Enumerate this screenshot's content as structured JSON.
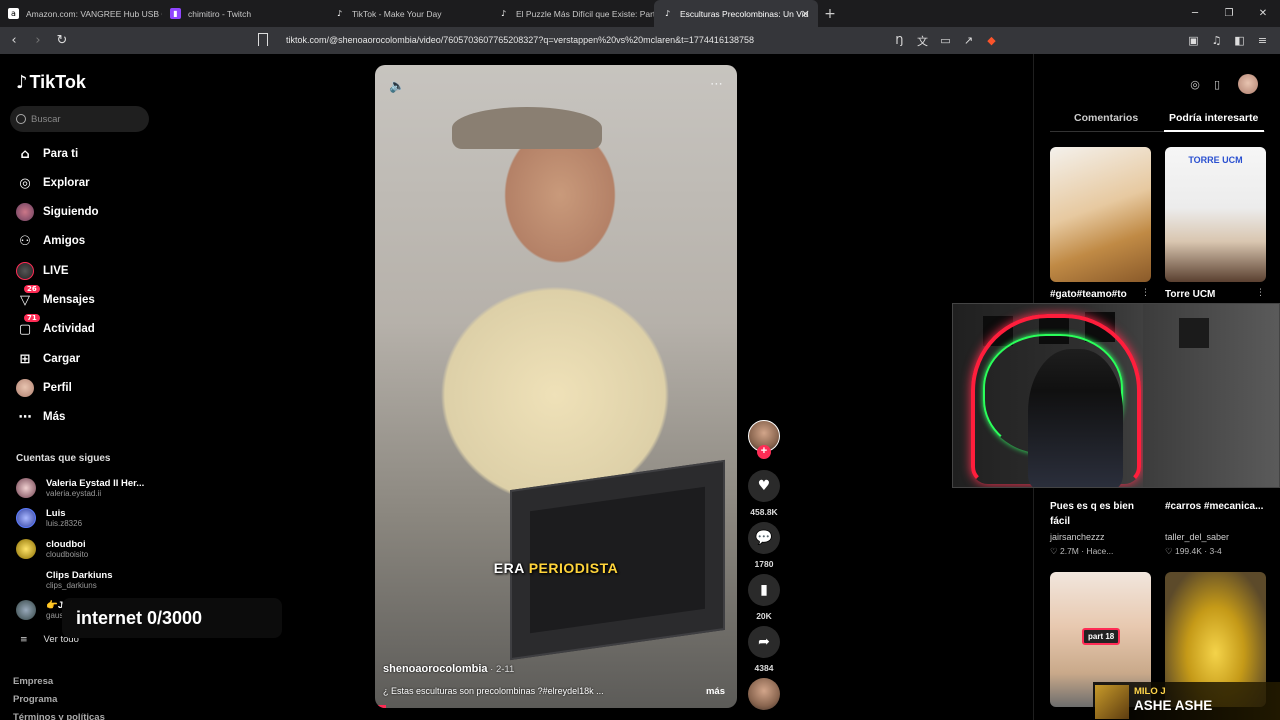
{
  "browser": {
    "tabs": [
      {
        "title": "Amazon.com: VANGREE Hub USB C,",
        "active": false,
        "icon": "amazon-icon"
      },
      {
        "title": "chimitiro - Twitch",
        "active": false,
        "icon": "twitch-icon"
      },
      {
        "title": "TikTok - Make Your Day",
        "active": false,
        "icon": "tiktok-icon"
      },
      {
        "title": "El Puzzle Más Difícil que Existe: Parte",
        "active": false,
        "icon": "tiktok-icon"
      },
      {
        "title": "Esculturas Precolombinas: Un Vid",
        "active": true,
        "icon": "tiktok-icon"
      }
    ],
    "url": "tiktok.com/@shenoaorocolombia/video/7605703607765208327?q=verstappen%20vs%20mclaren&t=1774416138758"
  },
  "sidebar": {
    "brand": "TikTok",
    "search_placeholder": "Buscar",
    "menu": [
      {
        "label": "Para ti",
        "icon": "home-icon"
      },
      {
        "label": "Explorar",
        "icon": "compass-icon"
      },
      {
        "label": "Siguiendo",
        "icon": "following-avatar-icon"
      },
      {
        "label": "Amigos",
        "icon": "friends-icon"
      },
      {
        "label": "LIVE",
        "icon": "live-icon"
      },
      {
        "label": "Mensajes",
        "icon": "messages-icon",
        "badge": "26"
      },
      {
        "label": "Actividad",
        "icon": "activity-icon",
        "badge": "71"
      },
      {
        "label": "Cargar",
        "icon": "upload-icon"
      },
      {
        "label": "Perfil",
        "icon": "profile-icon"
      },
      {
        "label": "Más",
        "icon": "more-icon"
      }
    ],
    "following_title": "Cuentas que sigues",
    "accounts": [
      {
        "name": "Valeria Eystad II Her...",
        "handle": "valeria.eystad.ii"
      },
      {
        "name": "Luis",
        "handle": "luis.z8326"
      },
      {
        "name": "cloudboi",
        "handle": "cloudboisito"
      },
      {
        "name": "Clips Darkiuns",
        "handle": "clips_darkiuns"
      },
      {
        "name": "👉JUEGO AQUÍ✅",
        "handle": "gauseylow"
      }
    ],
    "see_all": "Ver todo",
    "footer": [
      "Empresa",
      "Programa",
      "Términos y políticas"
    ]
  },
  "overlay_counter": "internet  0/3000",
  "video": {
    "subtitle_plain": "ERA ",
    "subtitle_highlight": "PERIODISTA",
    "author": "shenoaorocolombia",
    "date": " · 2-11",
    "description": "¿ Estas esculturas son precolombinas ?#elreydel18k ...",
    "more": "más",
    "progress": 0.03
  },
  "actions": {
    "likes": "458.8K",
    "comments": "1780",
    "saves": "20K",
    "shares": "4384"
  },
  "right_panel": {
    "tab_comments": "Comentarios",
    "tab_suggested": "Podría interesarte",
    "items": [
      {
        "title": "#gato#teamo#to",
        "author": "",
        "stats": ""
      },
      {
        "title": "Torre UCM",
        "author": "",
        "stats": "",
        "thumb_text": "TORRE UCM"
      },
      {
        "title": "Pues es q es bien fácil",
        "author": "jairsanchezzz",
        "stats": "♡ 2.7M  · Hace..."
      },
      {
        "title": "#carros #mecanica...",
        "author": "taller_del_saber",
        "stats": "♡ 199.4K  · 3-4"
      },
      {
        "title": "",
        "author": "",
        "stats": "",
        "thumb_text": "part 18"
      },
      {
        "title": "",
        "author": "",
        "stats": ""
      }
    ]
  },
  "now_playing": {
    "artist": "MILO J",
    "song": "ASHE ASHE"
  }
}
